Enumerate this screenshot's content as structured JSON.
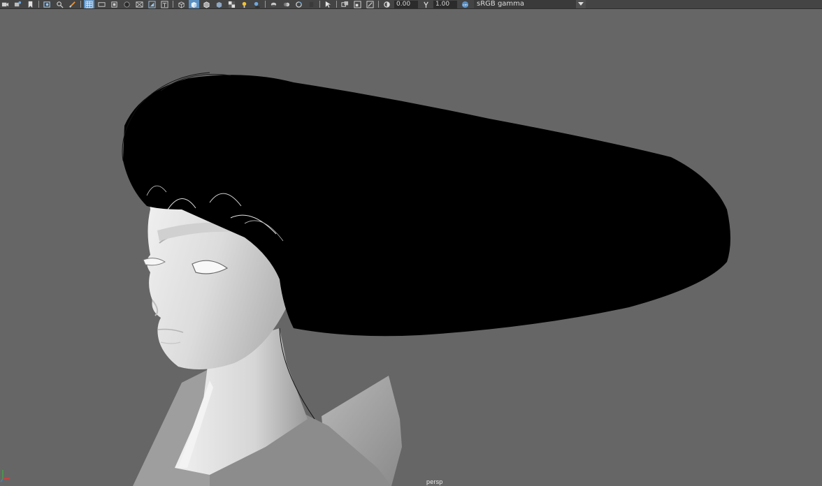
{
  "toolbar": {
    "icons": [
      "select-camera-icon",
      "camera-attributes-icon",
      "bookmark-icon",
      "image-plane-icon",
      "two-d-pan-icon",
      "grease-pencil-icon",
      "grid-icon",
      "film-gate-icon",
      "resolution-gate-icon",
      "gate-mask-icon",
      "field-chart-icon",
      "safe-action-icon",
      "safe-title-icon",
      "wireframe-icon",
      "smooth-shade-icon",
      "wireframe-on-shaded-icon",
      "use-default-material-icon",
      "textured-icon",
      "use-all-lights-icon",
      "shadows-icon",
      "screen-space-ao-icon",
      "motion-blur-icon",
      "anti-aliasing-icon",
      "depth-of-field-icon",
      "isolate-select-icon",
      "xray-icon",
      "xray-joints-icon",
      "xray-components-icon",
      "exposure-icon",
      "gamma-icon",
      "color-management-icon"
    ],
    "active_icons": [
      "grid-icon",
      "smooth-shade-icon"
    ],
    "exposure_value": "0.00",
    "gamma_value": "1.00",
    "color_space": "sRGB gamma"
  },
  "viewport": {
    "camera_name": "persp",
    "background_color": "#666666",
    "hair_color": "#000000",
    "skin_color": "#e4e4e4"
  }
}
